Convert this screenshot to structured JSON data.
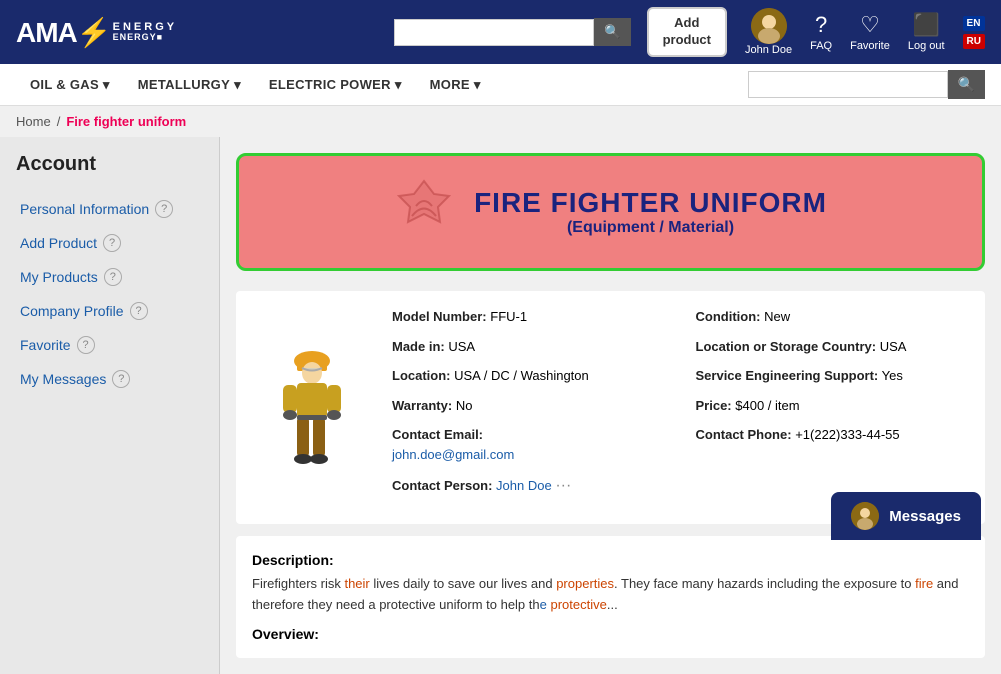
{
  "header": {
    "logo": {
      "ama": "AMA",
      "lightning": "⚡",
      "energy": "ENERGY"
    },
    "add_product_label": "Add\nproduct",
    "user_name": "John Doe",
    "faq_label": "FAQ",
    "favorite_label": "Favorite",
    "logout_label": "Log out",
    "search_placeholder": ""
  },
  "nav": {
    "items": [
      {
        "label": "OIL & GAS",
        "has_dropdown": true
      },
      {
        "label": "METALLURGY",
        "has_dropdown": true
      },
      {
        "label": "ELECTRIC POWER",
        "has_dropdown": true
      },
      {
        "label": "MORE",
        "has_dropdown": true
      }
    ]
  },
  "breadcrumb": {
    "home": "Home",
    "separator": "/",
    "current": "Fire fighter uniform"
  },
  "sidebar": {
    "title": "Account",
    "items": [
      {
        "label": "Personal Information",
        "has_help": true
      },
      {
        "label": "Add Product",
        "has_help": true
      },
      {
        "label": "My Products",
        "has_help": true
      },
      {
        "label": "Company Profile",
        "has_help": true
      },
      {
        "label": "Favorite",
        "has_help": true
      },
      {
        "label": "My Messages",
        "has_help": true
      }
    ]
  },
  "product": {
    "banner_title": "FIRE FIGHTER UNIFORM",
    "banner_subtitle": "(Equipment / Material)",
    "model_number_label": "Model Number:",
    "model_number": "FFU-1",
    "made_in_label": "Made in:",
    "made_in": "USA",
    "location_label": "Location:",
    "location": "USA / DC / Washington",
    "warranty_label": "Warranty:",
    "warranty": "No",
    "contact_email_label": "Contact Email:",
    "contact_email": "john.doe@gmail.com",
    "contact_person_label": "Contact Person:",
    "contact_person": "John Doe",
    "condition_label": "Condition:",
    "condition": "New",
    "location_storage_label": "Location or Storage Country:",
    "location_storage": "USA",
    "service_engineering_label": "Service Engineering Support:",
    "service_engineering": "Yes",
    "price_label": "Price:",
    "price": "$400 / item",
    "contact_phone_label": "Contact Phone:",
    "contact_phone": "+1(222)333-44-55",
    "description_title": "Description:",
    "description_text": "Firefighters risk their lives daily to save our lives and properties. They face many hazards including the exposure to fire and therefore they need a protective uniform to help th...",
    "overview_label": "Overview:"
  },
  "messages_popup": {
    "label": "Messages"
  }
}
